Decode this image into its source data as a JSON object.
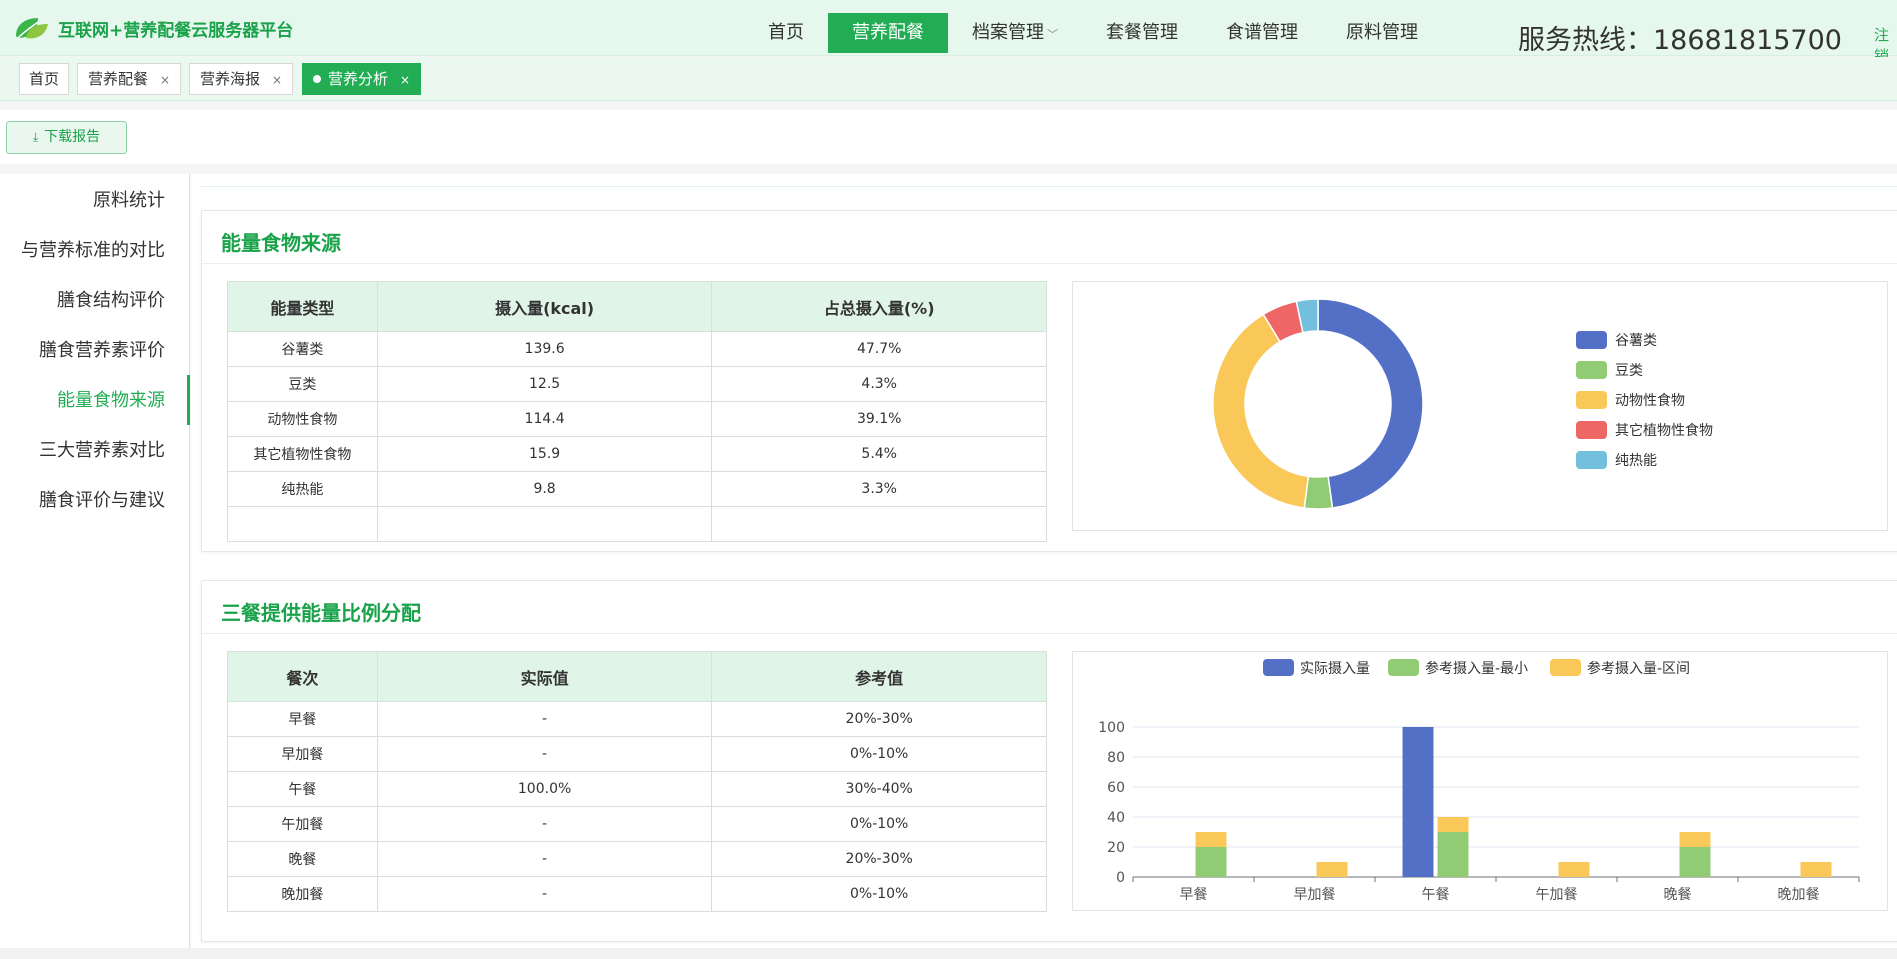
{
  "header": {
    "logo_text": "互联网+营养配餐云服务器平台",
    "nav": [
      {
        "label": "首页",
        "active": false
      },
      {
        "label": "营养配餐",
        "active": true
      },
      {
        "label": "档案管理",
        "active": false,
        "dropdown": true
      },
      {
        "label": "套餐管理",
        "active": false
      },
      {
        "label": "食谱管理",
        "active": false
      },
      {
        "label": "原料管理",
        "active": false
      }
    ],
    "hotline": "服务热线：18681815700",
    "register": "注销"
  },
  "tabs": [
    {
      "label": "首页",
      "closable": false
    },
    {
      "label": "营养配餐",
      "closable": true
    },
    {
      "label": "营养海报",
      "closable": true
    },
    {
      "label": "营养分析",
      "closable": true,
      "active": true
    }
  ],
  "toolbar": {
    "download_label": "下载报告"
  },
  "sidebar": {
    "items": [
      {
        "label": "原料统计"
      },
      {
        "label": "与营养标准的对比"
      },
      {
        "label": "膳食结构评价"
      },
      {
        "label": "膳食营养素评价"
      },
      {
        "label": "能量食物来源",
        "active": true
      },
      {
        "label": "三大营养素对比"
      },
      {
        "label": "膳食评价与建议"
      }
    ]
  },
  "energy_source": {
    "title": "能量食物来源",
    "headers": [
      "能量类型",
      "摄入量(kcal)",
      "占总摄入量(%)"
    ],
    "rows": [
      [
        "谷薯类",
        "139.6",
        "47.7%"
      ],
      [
        "豆类",
        "12.5",
        "4.3%"
      ],
      [
        "动物性食物",
        "114.4",
        "39.1%"
      ],
      [
        "其它植物性食物",
        "15.9",
        "5.4%"
      ],
      [
        "纯热能",
        "9.8",
        "3.3%"
      ]
    ]
  },
  "meal_ratio": {
    "title": "三餐提供能量比例分配",
    "headers": [
      "餐次",
      "实际值",
      "参考值"
    ],
    "rows": [
      [
        "早餐",
        "-",
        "20%-30%"
      ],
      [
        "早加餐",
        "-",
        "0%-10%"
      ],
      [
        "午餐",
        "100.0%",
        "30%-40%"
      ],
      [
        "午加餐",
        "-",
        "0%-10%"
      ],
      [
        "晚餐",
        "-",
        "20%-30%"
      ],
      [
        "晚加餐",
        "-",
        "0%-10%"
      ]
    ]
  },
  "colors": {
    "accent": "#22ad55",
    "blue": "#5470c6",
    "green": "#91cc75",
    "yellow": "#fac858",
    "red": "#ee6666",
    "cyan": "#73c0de"
  },
  "chart_data": [
    {
      "type": "pie",
      "donut": true,
      "categories": [
        "谷薯类",
        "豆类",
        "动物性食物",
        "其它植物性食物",
        "纯热能"
      ],
      "values": [
        47.7,
        4.3,
        39.1,
        5.4,
        3.3
      ],
      "colors": [
        "#5470c6",
        "#91cc75",
        "#fac858",
        "#ee6666",
        "#73c0de"
      ],
      "legend": "right"
    },
    {
      "type": "bar",
      "stacked_groups": true,
      "categories": [
        "早餐",
        "早加餐",
        "午餐",
        "午加餐",
        "晚餐",
        "晚加餐"
      ],
      "series": [
        {
          "name": "实际摄入量",
          "values": [
            0,
            0,
            100,
            0,
            0,
            0
          ],
          "color": "#5470c6"
        },
        {
          "name": "参考摄入量-最小",
          "values": [
            20,
            0,
            30,
            0,
            20,
            0
          ],
          "color": "#91cc75"
        },
        {
          "name": "参考摄入量-区间",
          "values": [
            10,
            10,
            10,
            10,
            10,
            10
          ],
          "color": "#fac858"
        }
      ],
      "ylim": [
        0,
        100
      ],
      "yticks": [
        0,
        20,
        40,
        60,
        80,
        100
      ],
      "grid": true,
      "legend": "top"
    }
  ]
}
